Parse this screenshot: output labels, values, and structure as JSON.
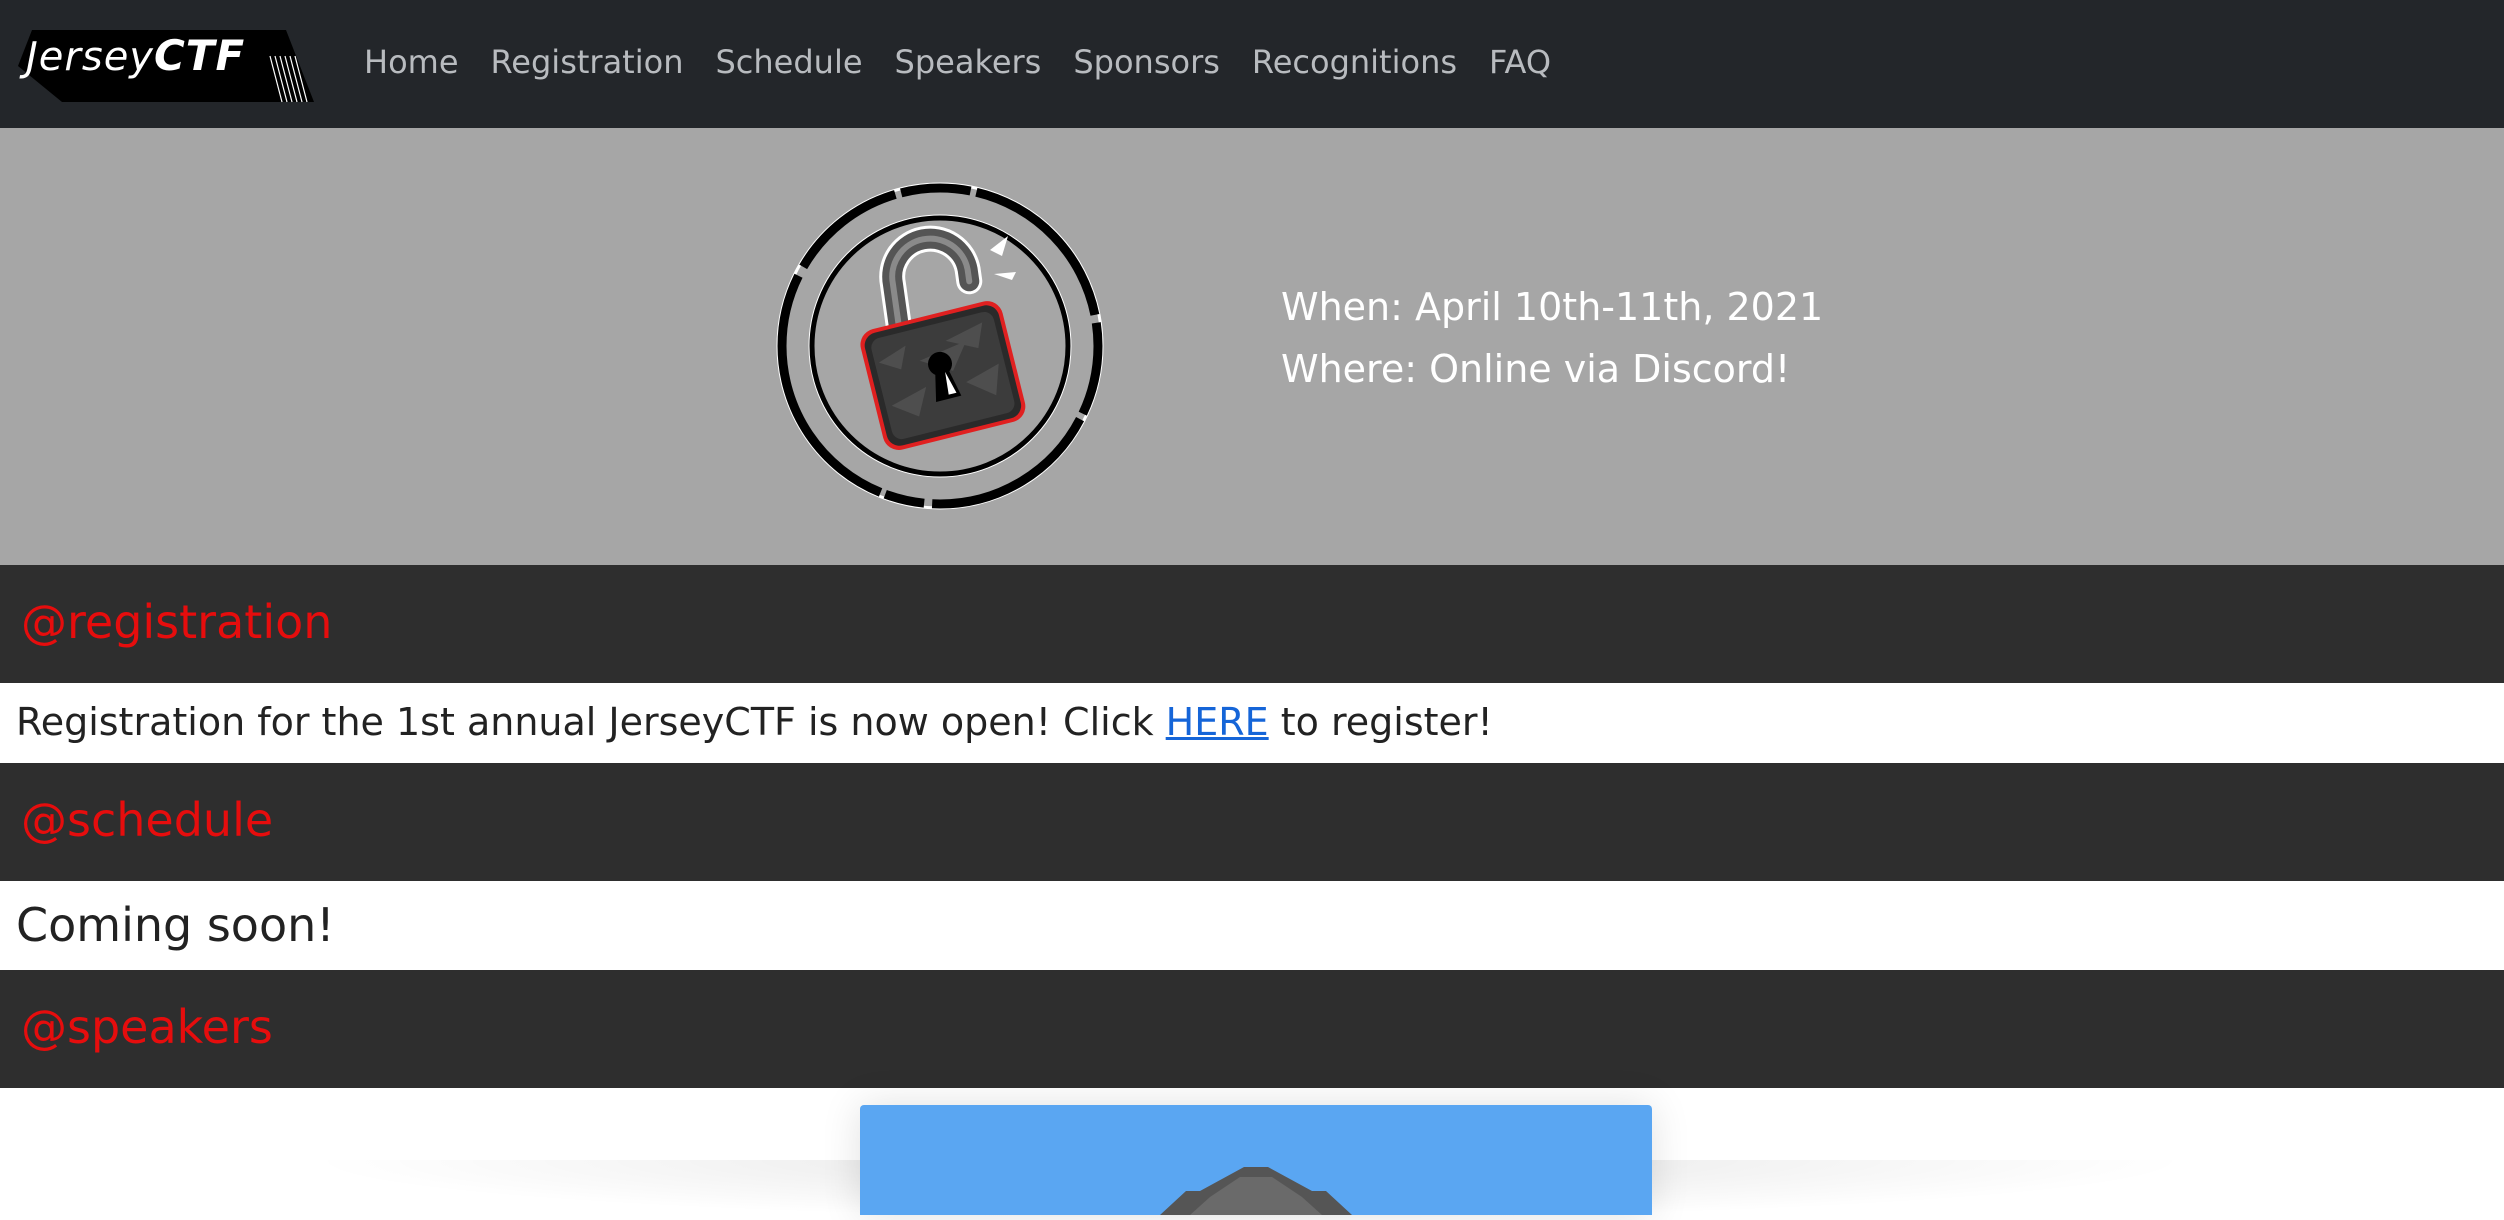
{
  "brand": {
    "name_part1": "Jersey",
    "name_part2": "CTF"
  },
  "nav": {
    "items": [
      "Home",
      "Registration",
      "Schedule",
      "Speakers",
      "Sponsors",
      "Recognitions",
      "FAQ"
    ]
  },
  "hero": {
    "when": "When: April 10th-11th, 2021",
    "where": "Where: Online via Discord!",
    "logo_icon": "unlocked-padlock-icon"
  },
  "sections": {
    "registration": {
      "title": "@registration",
      "text_before": "Registration for the 1st annual JerseyCTF is now open! Click ",
      "link": "HERE",
      "text_after": " to register!"
    },
    "schedule": {
      "title": "@schedule",
      "text": "Coming soon!"
    },
    "speakers": {
      "title": "@speakers"
    }
  },
  "colors": {
    "navbar_bg": "#23262a",
    "hero_bg": "#a6a6a6",
    "section_header_bg": "#2e2e2e",
    "section_title": "#e60d0d",
    "link": "#1565d8",
    "speaker_card": "#5aa6f2"
  }
}
